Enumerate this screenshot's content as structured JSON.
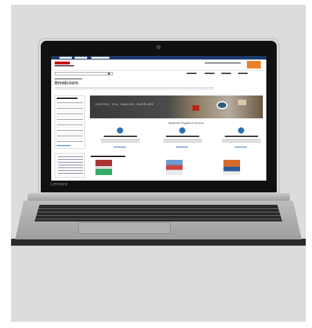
{
  "laptop": {
    "brand_label": "Lenovo"
  },
  "website": {
    "page_title": "Breakroom",
    "banner_text": "COFFEE, TEA, SNACKS, SUPPLIES",
    "services_title": "Breakroom Programs & Services"
  },
  "colors": {
    "backdrop": "#dcdcdc",
    "site_nav": "#1d3a6e",
    "brand_red": "#cc0000",
    "cart_orange": "#e8812a",
    "service_blue": "#2f6fb3"
  }
}
